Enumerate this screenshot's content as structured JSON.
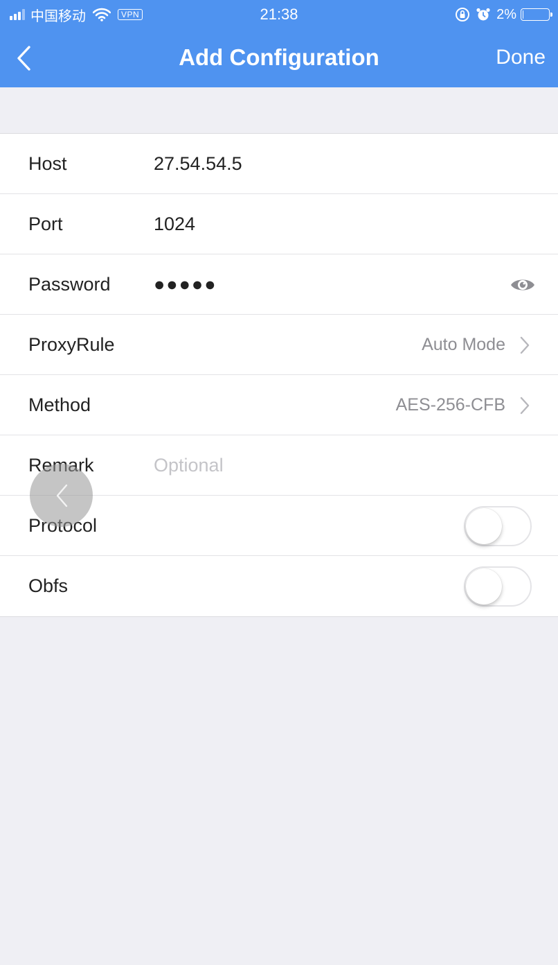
{
  "status_bar": {
    "carrier": "中国移动",
    "vpn": "VPN",
    "time": "21:38",
    "battery": "2%",
    "battery_level_fraction": 0.02,
    "signal_bars_filled": 3,
    "signal_bars_total": 4
  },
  "nav": {
    "title": "Add Configuration",
    "done_label": "Done"
  },
  "form": {
    "host": {
      "label": "Host",
      "value": "27.54.54.5"
    },
    "port": {
      "label": "Port",
      "value": "1024"
    },
    "password": {
      "label": "Password",
      "value": "●●●●●"
    },
    "proxy_rule": {
      "label": "ProxyRule",
      "value": "Auto Mode"
    },
    "method": {
      "label": "Method",
      "value": "AES-256-CFB"
    },
    "remark": {
      "label": "Remark",
      "placeholder": "Optional"
    },
    "protocol": {
      "label": "Protocol",
      "enabled": false
    },
    "obfs": {
      "label": "Obfs",
      "enabled": false
    }
  },
  "colors": {
    "accent": "#4f93f0",
    "background": "#efeff4",
    "text": "#222222",
    "secondary_text": "#8e8e93",
    "placeholder": "#c4c4c8"
  },
  "icons": {
    "back": "chevron-left-icon",
    "wifi": "wifi-icon",
    "orientation_lock": "orientation-lock-icon",
    "alarm": "alarm-icon",
    "battery": "battery-icon",
    "eye": "eye-icon",
    "disclosure": "chevron-right-icon",
    "floating": "floating-back-icon"
  }
}
